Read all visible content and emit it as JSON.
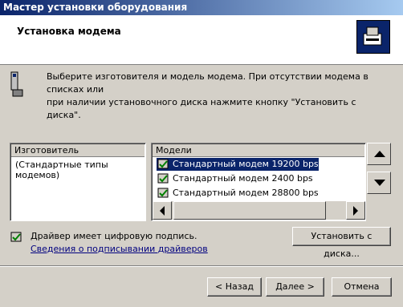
{
  "window": {
    "title": "Мастер установки оборудования"
  },
  "header": {
    "title": "Установка модема",
    "icon": "modem-install-icon"
  },
  "description": {
    "line1": "Выберите изготовителя и модель модема. При отсутствии модема в списках или",
    "line2": "при наличии установочного диска нажмите кнопку \"Установить с диска\".",
    "icon": "phone-modem-icon"
  },
  "manufacturers": {
    "header": "Изготовитель",
    "items": [
      "(Стандартные типы модемов)"
    ]
  },
  "models": {
    "header": "Модели",
    "items": [
      {
        "label": "Стандартный модем 19200 bps",
        "selected": true
      },
      {
        "label": "Стандартный модем 2400 bps",
        "selected": false
      },
      {
        "label": "Стандартный модем 28800 bps",
        "selected": false
      }
    ]
  },
  "signature": {
    "text": "Драйвер имеет цифровую подпись.",
    "link": "Сведения о подписывании драйверов"
  },
  "buttons": {
    "install_disk": "Установить с диска...",
    "back": "< Назад",
    "next": "Далее >",
    "cancel": "Отмена"
  }
}
